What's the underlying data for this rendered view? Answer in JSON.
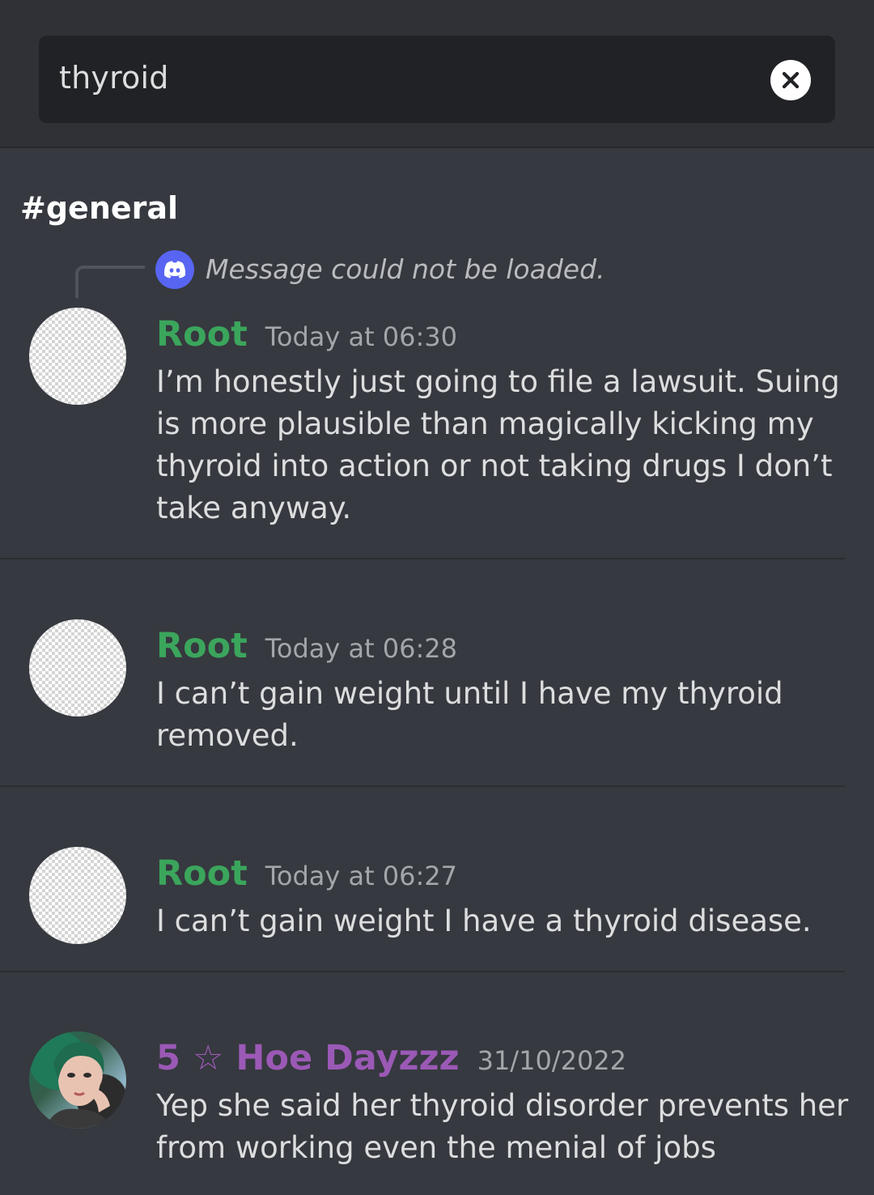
{
  "search": {
    "query": "thyroid",
    "clear_icon": "close-icon"
  },
  "channel": {
    "name": "#general"
  },
  "reply_reference": {
    "text": "Message could not be loaded.",
    "icon": "discord-logo-icon",
    "color": "#5865f2"
  },
  "messages": [
    {
      "username": "Root",
      "username_color": "#3ba55c",
      "timestamp": "Today at 06:30",
      "content": "I’m honestly just going to file a lawsuit. Suing is more plausible than magically kicking my thyroid into action or not taking drugs I don’t take anyway."
    },
    {
      "username": "Root",
      "username_color": "#3ba55c",
      "timestamp": "Today at 06:28",
      "content": "I can’t gain weight until I have my thyroid removed."
    },
    {
      "username": "Root",
      "username_color": "#3ba55c",
      "timestamp": "Today at 06:27",
      "content": "I can’t gain weight I have a thyroid disease."
    },
    {
      "username": "5 ☆ Hoe Dayzzz",
      "username_color": "#9b59b6",
      "timestamp": "31/10/2022",
      "content": "Yep she said her thyroid disorder prevents her from working even the menial of jobs"
    }
  ]
}
